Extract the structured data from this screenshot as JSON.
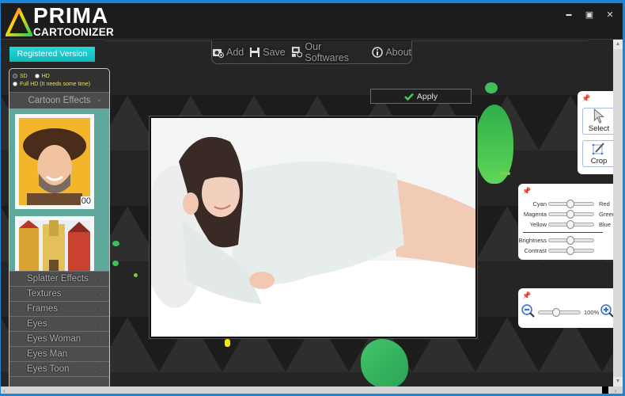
{
  "app": {
    "logo_line1": "PRIMA",
    "logo_line2": "CARTOONIZER",
    "window_controls": {
      "minimize": "▬",
      "maximize": "▣",
      "close": "✕"
    }
  },
  "toolbar": {
    "items": [
      {
        "label": "Add",
        "icon": "add-photo-icon"
      },
      {
        "label": "Save",
        "icon": "floppy-disk-icon"
      },
      {
        "label": "Our Softwares",
        "icon": "software-icon"
      },
      {
        "label": "About",
        "icon": "info-icon"
      }
    ]
  },
  "registered_label": "Registered Version",
  "resolution": {
    "options": [
      {
        "label": "SD",
        "selected": true
      },
      {
        "label": "HD",
        "selected": false
      },
      {
        "label": "Full HD (It needs some time)",
        "selected": false
      }
    ]
  },
  "sidebar": {
    "expanded_section": "Cartoon Effects",
    "thumbnails": [
      {
        "name": "cartoon-man-hat",
        "badge": "00"
      },
      {
        "name": "cartoon-town",
        "badge": ""
      }
    ],
    "sections": [
      {
        "label": "Splatter Effects"
      },
      {
        "label": "Textures"
      },
      {
        "label": "Frames"
      },
      {
        "label": "Eyes"
      },
      {
        "label": "Eyes Woman"
      },
      {
        "label": "Eyes Man"
      },
      {
        "label": "Eyes Toon"
      }
    ],
    "expand_glyph": "⌄",
    "arrow_glyph": "›"
  },
  "apply_label": "Apply",
  "tools": {
    "select_label": "Select",
    "crop_label": "Crop"
  },
  "color_adjust": {
    "balance": [
      {
        "left": "Cyan",
        "right": "Red",
        "value": 0.5
      },
      {
        "left": "Magenta",
        "right": "Green",
        "value": 0.5
      },
      {
        "left": "Yellow",
        "right": "Blue",
        "value": 0.5
      }
    ],
    "levels": [
      {
        "label": "Brightness",
        "value": 0.5
      },
      {
        "label": "Contrast",
        "value": 0.5
      }
    ]
  },
  "zoom": {
    "label": "100%",
    "value": 0.45
  },
  "colors": {
    "accent_cyan": "#1ec7ca",
    "window_border": "#1b86d9",
    "apply_check": "#3fcf4a",
    "radio_text": "#f2e040",
    "splash_green": "#3fbf5c"
  }
}
